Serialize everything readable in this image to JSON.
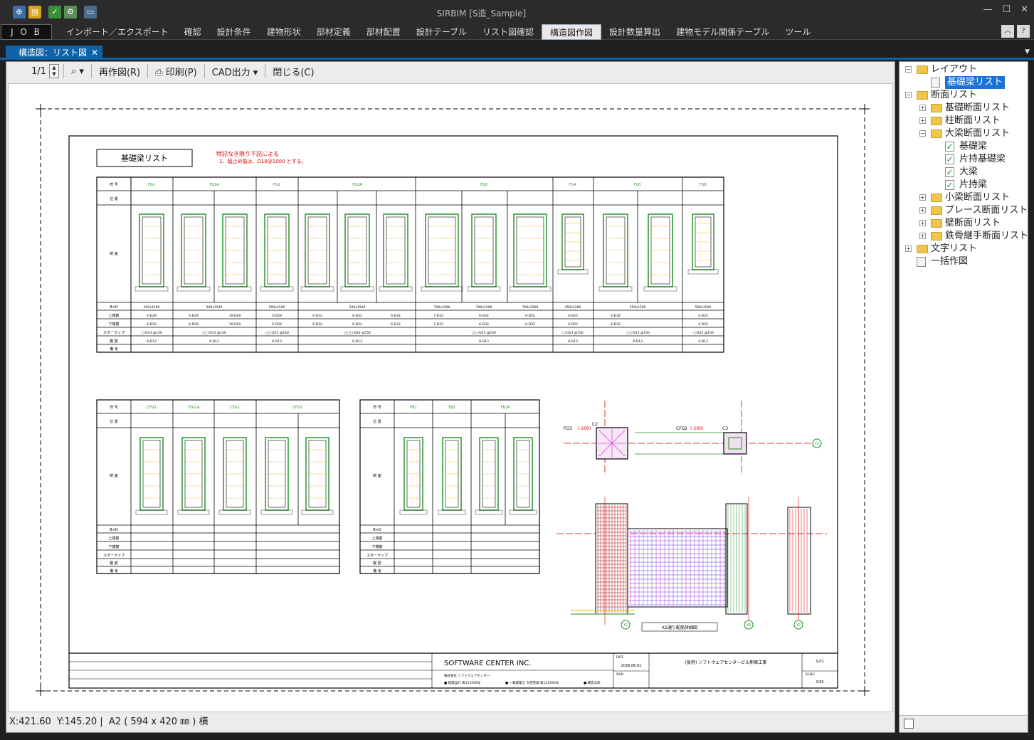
{
  "app": {
    "title": "SIRBIM  [S造_Sample]"
  },
  "quick_icons": [
    "new-icon",
    "open-icon",
    "check-icon",
    "settings-icon",
    "monitor-icon"
  ],
  "window_controls": {
    "minimize": "—",
    "maximize": "☐",
    "close": "✕"
  },
  "menubar": {
    "job": "J O B",
    "items": [
      "インポート／エクスポート",
      "確認",
      "設計条件",
      "建物形状",
      "部材定義",
      "部材配置",
      "設計テーブル",
      "リスト図確認",
      "構造図作図",
      "設計数量算出",
      "建物モデル関係テーブル",
      "ツール"
    ],
    "active": "構造図作図"
  },
  "tab": {
    "label": "構造図：リスト図",
    "close": "✕"
  },
  "toolbar": {
    "page": "1/1",
    "redraw": "再作図(R)",
    "print": "印刷(P)",
    "cad": "CAD出力",
    "close": "閉じる(C)"
  },
  "drawing": {
    "title": "基礎梁リスト",
    "note1": "特記なき限り下記による",
    "note2": "1．幅止め筋は、D10@1000 とする。",
    "t1_headers": [
      "符 号",
      "位 置",
      "断 面",
      "B×D",
      "上端筋",
      "下端筋",
      "スターラップ",
      "腹 筋",
      "備 考"
    ],
    "t1_cols": [
      "FG1",
      "FG1A",
      "FG2",
      "FG2A",
      "FG3",
      "FG4",
      "FG5",
      "FG6"
    ],
    "t1_bxd": [
      "500x1500",
      "500x1500",
      "500x1500",
      "500x1500",
      "700x1500",
      "700x1500",
      "700x1500",
      "450x1200",
      "550x1500",
      "550x1500",
      "400x1200"
    ],
    "t1_top": [
      "6-D29",
      "6-D29",
      "10-D29",
      "5-D29",
      "6-D32",
      "6-D32",
      "6-D32",
      "7-D32",
      "6-D32",
      "6-D32",
      "4-D25",
      "6-D32",
      "4-D25"
    ],
    "t1_stir": [
      "□-D13 @150",
      "□□-D13 @150",
      "□□-D13 @150",
      "□□□-D13 @150",
      "□□-D13 @150",
      "□-D13 @150",
      "□□-D13 @150",
      "□-D13 @150"
    ],
    "t1_web": [
      "8-D13",
      "8-D13",
      "8-D13",
      "8-D13",
      "8-D13",
      "8-D13",
      "8-D13",
      "4-D13"
    ],
    "t2_cols": [
      "CFG1",
      "CFG1A",
      "CFG2",
      "CFG3"
    ],
    "t3_cols": [
      "FB1",
      "FB2",
      "FB2A"
    ],
    "company": "SOFTWARE CENTER INC.",
    "project": "(仮称) ソフトウェアセンタービル新築工事",
    "date": "2026.06.01",
    "sheet": "S-01",
    "scale": "1/50",
    "plan_label": "X2通り配筋詳細図",
    "grid_marks": [
      "Y2",
      "X2",
      "X3",
      "Y2"
    ]
  },
  "status": {
    "x": "X:421.60",
    "y": "Y:145.20",
    "paper": "A2 ( 594 x 420 ㎜ ) 横"
  },
  "tree": [
    {
      "level": 0,
      "type": "folder",
      "label": "レイアウト",
      "expanded": true
    },
    {
      "level": 1,
      "type": "list",
      "label": "基礎梁リスト",
      "selected": true
    },
    {
      "level": 0,
      "type": "folder",
      "label": "断面リスト",
      "expanded": true
    },
    {
      "level": 1,
      "type": "folder",
      "label": "基礎断面リスト"
    },
    {
      "level": 1,
      "type": "folder",
      "label": "柱断面リスト"
    },
    {
      "level": 1,
      "type": "folder",
      "label": "大梁断面リスト",
      "expanded": true
    },
    {
      "level": 2,
      "type": "check",
      "label": "基礎梁"
    },
    {
      "level": 2,
      "type": "check",
      "label": "片持基礎梁"
    },
    {
      "level": 2,
      "type": "check",
      "label": "大梁"
    },
    {
      "level": 2,
      "type": "check",
      "label": "片持梁"
    },
    {
      "level": 1,
      "type": "folder",
      "label": "小梁断面リスト"
    },
    {
      "level": 1,
      "type": "folder",
      "label": "ブレース断面リスト"
    },
    {
      "level": 1,
      "type": "folder",
      "label": "壁断面リスト"
    },
    {
      "level": 1,
      "type": "folder",
      "label": "鉄骨継手断面リスト"
    },
    {
      "level": 0,
      "type": "folder",
      "label": "文字リスト"
    },
    {
      "level": 0,
      "type": "list",
      "label": "一括作図"
    }
  ]
}
